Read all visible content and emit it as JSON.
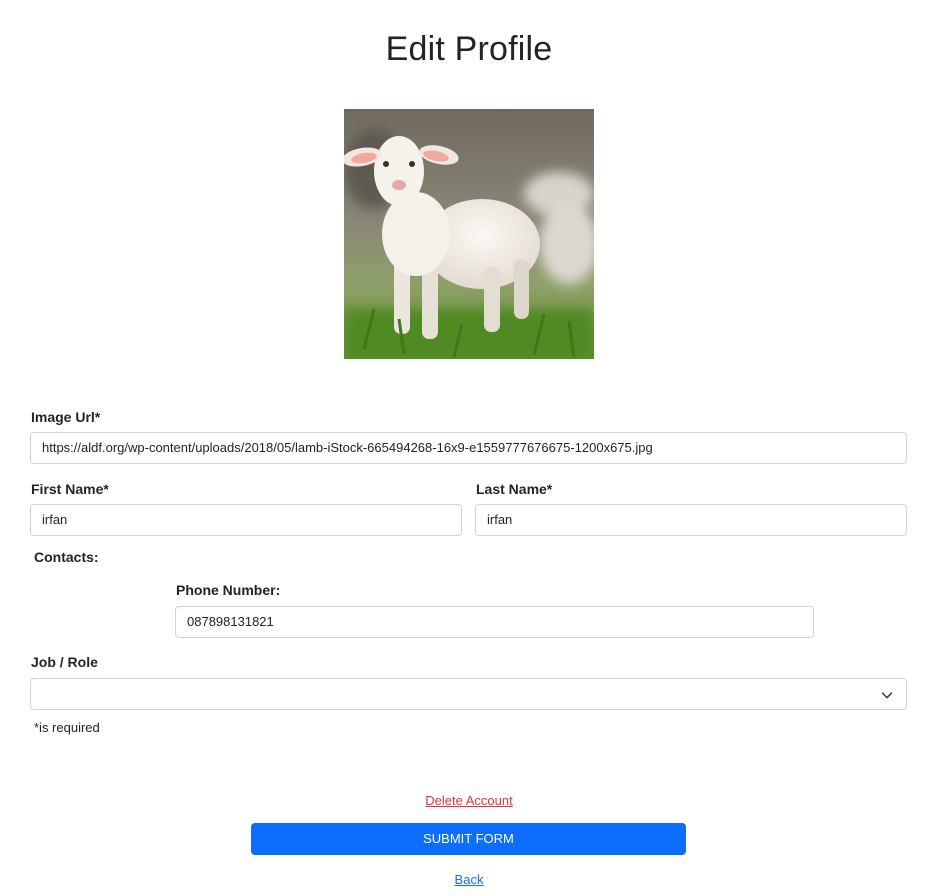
{
  "page": {
    "title": "Edit Profile"
  },
  "profile_photo": {
    "alt": "lamb"
  },
  "form": {
    "image_url": {
      "label": "Image Url*",
      "value": "https://aldf.org/wp-content/uploads/2018/05/lamb-iStock-665494268-16x9-e1559777676675-1200x675.jpg"
    },
    "first_name": {
      "label": "First Name*",
      "value": "irfan"
    },
    "last_name": {
      "label": "Last Name*",
      "value": "irfan"
    },
    "contacts": {
      "label": "Contacts:"
    },
    "phone": {
      "label": "Phone Number:",
      "value": "087898131821"
    },
    "job_role": {
      "label": "Job / Role",
      "value": ""
    },
    "required_note": "*is required"
  },
  "actions": {
    "delete_label": "Delete Account",
    "submit_label": "SUBMIT FORM",
    "back_label": "Back"
  },
  "colors": {
    "primary": "#0d6efd",
    "danger": "#dc3545",
    "text": "#212529",
    "border": "#ced4da"
  }
}
